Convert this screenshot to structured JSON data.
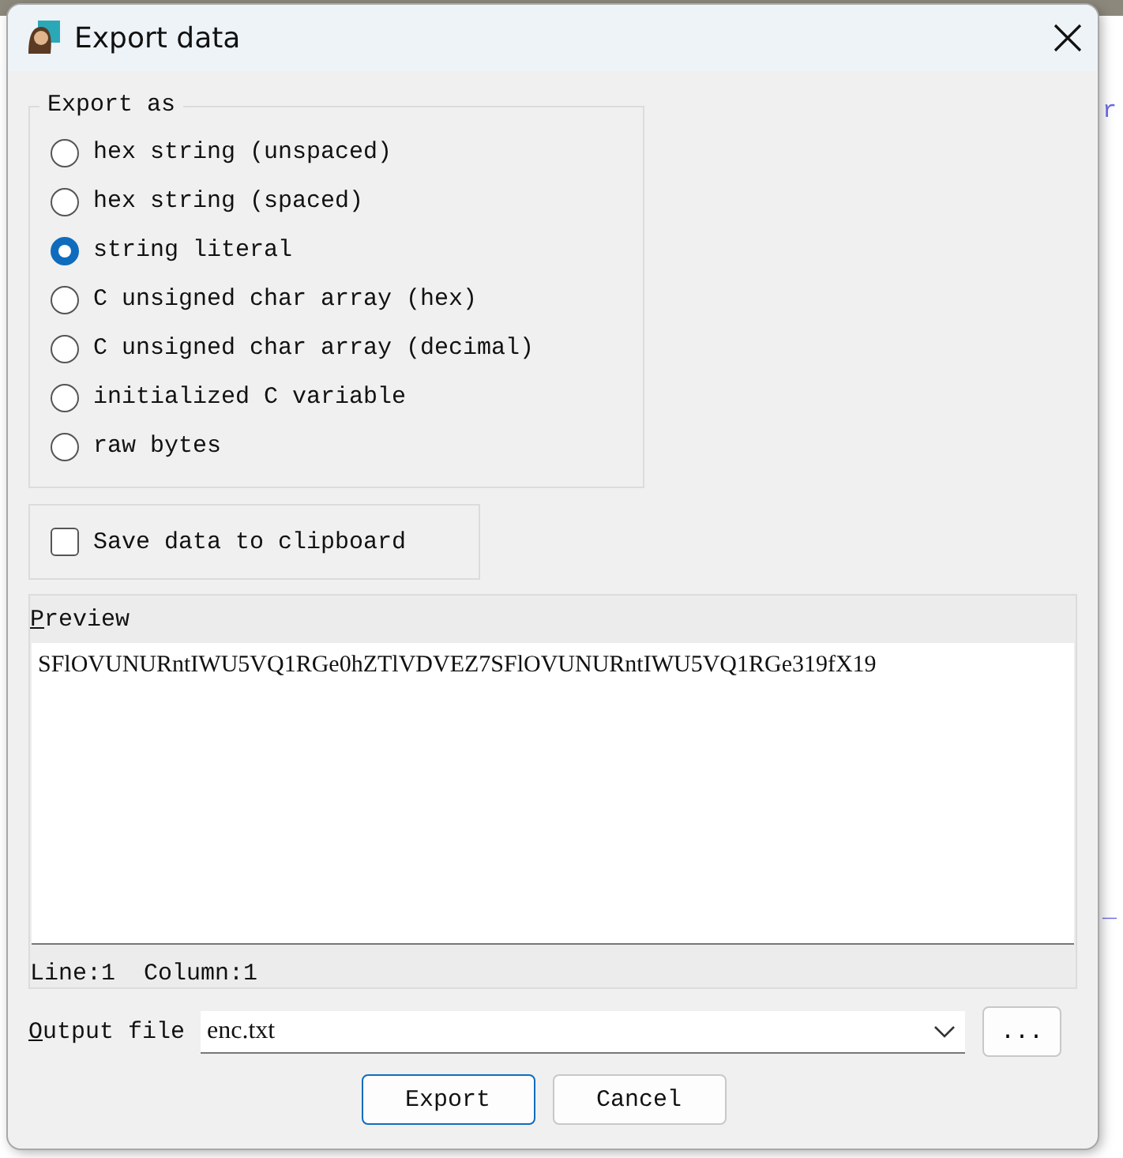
{
  "background_text": [
    "r",
    "_"
  ],
  "window": {
    "title": "Export data"
  },
  "export_as": {
    "title": "Export as",
    "options": [
      {
        "label": "hex string (unspaced)",
        "selected": false
      },
      {
        "label": "hex string (spaced)",
        "selected": false
      },
      {
        "label": "string literal",
        "selected": true
      },
      {
        "label": "C unsigned char array (hex)",
        "selected": false
      },
      {
        "label": "C unsigned char array (decimal)",
        "selected": false
      },
      {
        "label": "initialized C variable",
        "selected": false
      },
      {
        "label": "raw bytes",
        "selected": false
      }
    ]
  },
  "save_to_clipboard": {
    "label": "Save data to clipboard",
    "checked": false
  },
  "preview": {
    "title": "Preview",
    "text": "SFlOVUNURntIWU5VQ1RGe0hZTlVDVEZ7SFlOVUNURntIWU5VQ1RGe319fX19",
    "status": "Line:1  Column:1"
  },
  "output_file": {
    "label": "Output file",
    "value": "enc.txt",
    "browse": "..."
  },
  "buttons": [
    {
      "label": "Export",
      "default": true
    },
    {
      "label": "Cancel",
      "default": false
    }
  ]
}
